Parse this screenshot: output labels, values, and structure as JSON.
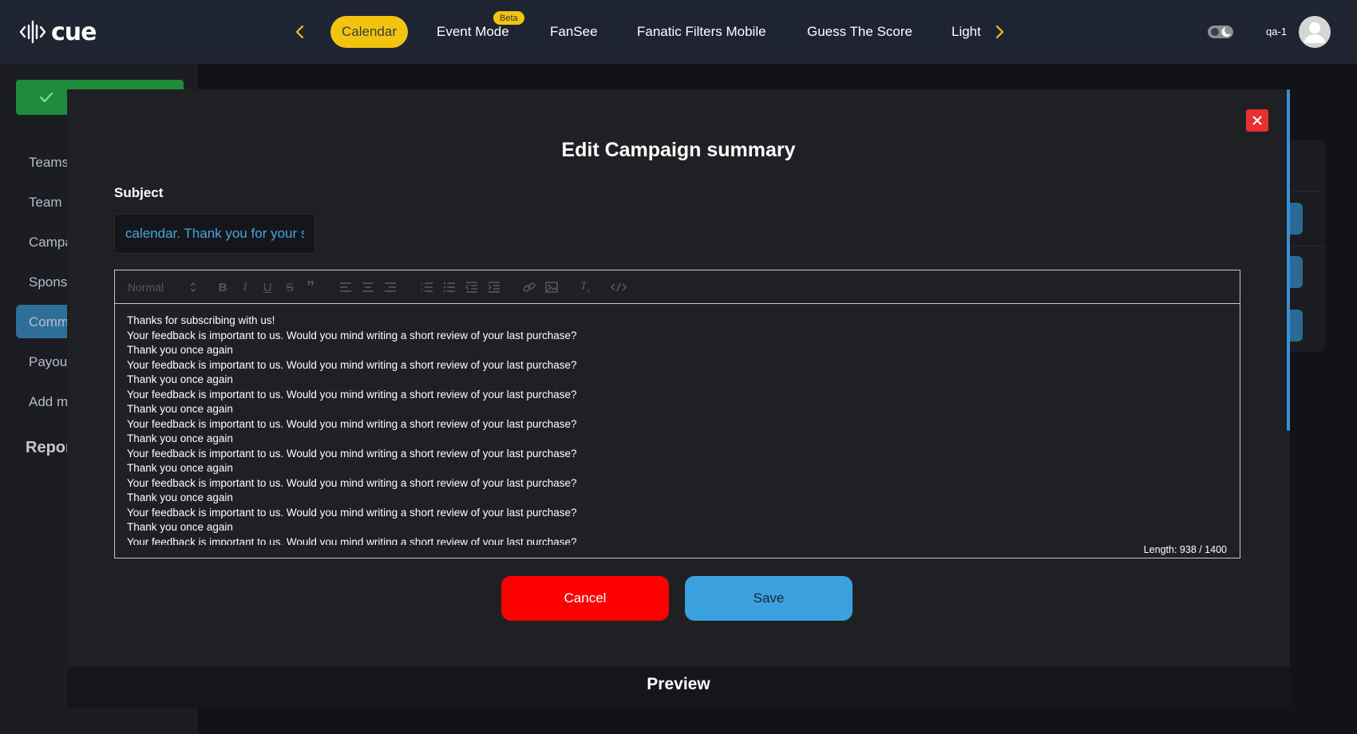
{
  "brand": {
    "name": "cue",
    "accent": "#f1c40f"
  },
  "nav": {
    "tabs": [
      {
        "label": "Calendar",
        "active": true
      },
      {
        "label": "Event Mode",
        "badge": "Beta"
      },
      {
        "label": "FanSee"
      },
      {
        "label": "Fanatic Filters Mobile"
      },
      {
        "label": "Guess The Score"
      },
      {
        "label": "Light"
      }
    ],
    "prev_icon": "chevron-left-icon",
    "next_icon": "chevron-right-icon"
  },
  "user": {
    "name": "qa-1",
    "avatar_icon": "user-icon",
    "theme_toggle_icon": "theme-toggle-icon"
  },
  "sidebar": {
    "items": [
      {
        "label": "Teams"
      },
      {
        "label": "Team"
      },
      {
        "label": "Campa"
      },
      {
        "label": "Spons"
      },
      {
        "label": "Comm",
        "active": true
      },
      {
        "label": "Payou"
      },
      {
        "label": "Add m"
      }
    ],
    "section": "Repor"
  },
  "modal": {
    "title": "Edit Campaign summary",
    "subject_label": "Subject",
    "subject_value": "calendar. Thank you for your subscription",
    "editor": {
      "format_select": "Normal",
      "toolbar_icons": [
        "bold-icon",
        "italic-icon",
        "underline-icon",
        "strike-icon",
        "quote-icon",
        "align-left-icon",
        "align-center-icon",
        "align-right-icon",
        "ordered-list-icon",
        "bullet-list-icon",
        "outdent-icon",
        "indent-icon",
        "link-icon",
        "image-icon",
        "clear-format-icon",
        "code-icon"
      ],
      "lines": [
        "Thanks for subscribing with us!",
        "Your feedback is important to us. Would you mind writing a short review of your last purchase?",
        "Thank you once again",
        "Your feedback is important to us. Would you mind writing a short review of your last purchase?",
        "Thank you once again",
        "Your feedback is important to us. Would you mind writing a short review of your last purchase?",
        "Thank you once again",
        "Your feedback is important to us. Would you mind writing a short review of your last purchase?",
        "Thank you once again",
        "Your feedback is important to us. Would you mind writing a short review of your last purchase?",
        "Thank you once again",
        "Your feedback is important to us. Would you mind writing a short review of your last purchase?",
        "Thank you once again",
        "Your feedback is important to us. Would you mind writing a short review of your last purchase?",
        "Thank you once again",
        "Your feedback is important to us. Would you mind writing a short review of your last purchase?"
      ],
      "length": "Length: 938 / 1400"
    },
    "cancel_label": "Cancel",
    "save_label": "Save",
    "preview_title": "Preview",
    "colors": {
      "cancel": "#ff0000",
      "save": "#3aa0de",
      "close": "#e83030"
    }
  }
}
